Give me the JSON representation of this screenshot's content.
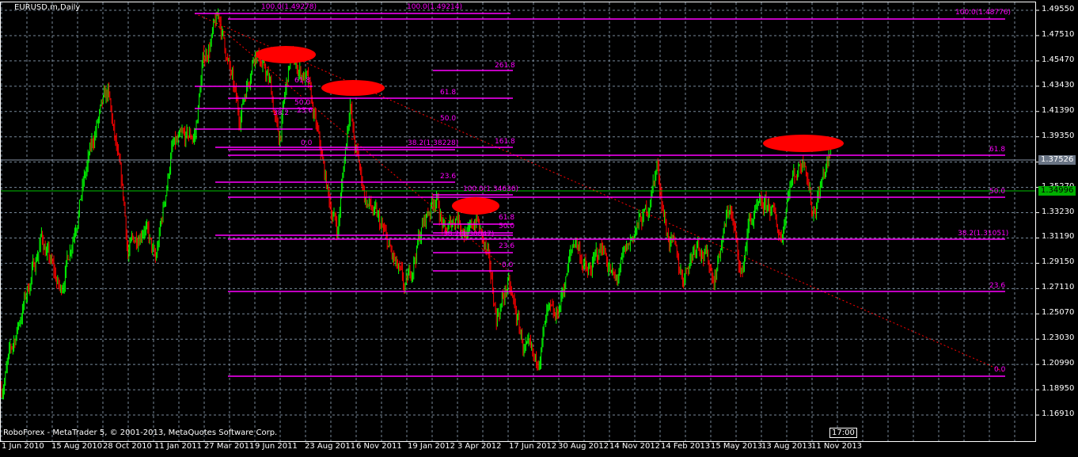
{
  "window": {
    "title": "EURUSD.m,Daily"
  },
  "footer": {
    "copyright": "RoboForex - MetaTrader 5, © 2001-2013, MetaQuotes Software Corp.",
    "time_marker": "17:00"
  },
  "colors": {
    "background": "#000000",
    "grid": "#778899",
    "bull": "#00ff00",
    "bear": "#ff0000",
    "fib": "#ff00ff",
    "trend": "#ff0000",
    "bid_line": "#8896a8",
    "ask_line": "#00c000"
  },
  "price_axis": {
    "ticks": [
      "1.49550",
      "1.47510",
      "1.45470",
      "1.43430",
      "1.41390",
      "1.39350",
      "1.37310",
      "1.35270",
      "1.33230",
      "1.31190",
      "1.29150",
      "1.27110",
      "1.25070",
      "1.23030",
      "1.20990",
      "1.18950",
      "1.16910"
    ],
    "current_bid": "1.37526",
    "current_ask": "1.34996"
  },
  "time_axis": {
    "ticks": [
      "1 Jun 2010",
      "15 Aug 2010",
      "28 Oct 2010",
      "11 Jan 2011",
      "27 Mar 2011",
      "9 Jun 2011",
      "23 Aug 2011",
      "6 Nov 2011",
      "19 Jan 2012",
      "3 Apr 2012",
      "17 Jun 2012",
      "30 Aug 2012",
      "14 Nov 2012",
      "14 Feb 2013",
      "15 May 2013",
      "13 Aug 2013",
      "11 Nov 2013"
    ]
  },
  "fib_labels": [
    "100.0(1.49278)",
    "100.0(1.49214)",
    "100.0(1.48776)",
    "261.8",
    "61.8",
    "50.0",
    "161.8",
    "38.2(1.38228)",
    "61.8",
    "23.6",
    "100.0(1.34636)",
    "50.0",
    "61.8",
    "50.0",
    "38.2(1.30847)",
    "38.2(1.31051)",
    "23.6",
    "0.0",
    "23.6",
    "0.0",
    "61.8",
    "50.0",
    "38.2",
    "23.6",
    "0.0"
  ],
  "chart_data": {
    "type": "candlestick",
    "symbol": "EURUSD.m",
    "timeframe": "Daily",
    "ylim": [
      1.1591,
      1.5057
    ],
    "path_bar_price": [
      [
        0,
        1.191
      ],
      [
        42,
        1.3126
      ],
      [
        62,
        1.2678
      ],
      [
        83,
        1.3446
      ],
      [
        100,
        1.4021
      ],
      [
        112,
        1.4277
      ],
      [
        129,
        1.3382
      ],
      [
        133,
        1.2998
      ],
      [
        150,
        1.3254
      ],
      [
        162,
        1.2902
      ],
      [
        179,
        1.3829
      ],
      [
        204,
        1.3957
      ],
      [
        212,
        1.4533
      ],
      [
        229,
        1.4904
      ],
      [
        250,
        1.4085
      ],
      [
        267,
        1.4661
      ],
      [
        283,
        1.4341
      ],
      [
        292,
        1.3893
      ],
      [
        304,
        1.4565
      ],
      [
        321,
        1.4405
      ],
      [
        333,
        1.3925
      ],
      [
        346,
        1.3382
      ],
      [
        354,
        1.319
      ],
      [
        367,
        1.4245
      ],
      [
        371,
        1.3893
      ],
      [
        383,
        1.3446
      ],
      [
        400,
        1.319
      ],
      [
        425,
        1.2678
      ],
      [
        442,
        1.319
      ],
      [
        457,
        1.3478
      ],
      [
        467,
        1.3126
      ],
      [
        479,
        1.3318
      ],
      [
        492,
        1.3126
      ],
      [
        500,
        1.3286
      ],
      [
        512,
        1.2934
      ],
      [
        521,
        1.2487
      ],
      [
        533,
        1.2742
      ],
      [
        542,
        1.2487
      ],
      [
        550,
        1.2231
      ],
      [
        562,
        1.2071
      ],
      [
        575,
        1.2487
      ],
      [
        583,
        1.2423
      ],
      [
        596,
        1.287
      ],
      [
        604,
        1.3126
      ],
      [
        617,
        1.2806
      ],
      [
        633,
        1.3062
      ],
      [
        646,
        1.2742
      ],
      [
        667,
        1.319
      ],
      [
        679,
        1.3318
      ],
      [
        690,
        1.3702
      ],
      [
        700,
        1.319
      ],
      [
        717,
        1.2806
      ],
      [
        733,
        1.3126
      ],
      [
        750,
        1.2806
      ],
      [
        767,
        1.3382
      ],
      [
        779,
        1.2806
      ],
      [
        787,
        1.3254
      ],
      [
        808,
        1.3382
      ],
      [
        821,
        1.3126
      ],
      [
        829,
        1.3542
      ],
      [
        846,
        1.3797
      ],
      [
        854,
        1.3318
      ],
      [
        867,
        1.367
      ],
      [
        873,
        1.3766
      ]
    ]
  }
}
